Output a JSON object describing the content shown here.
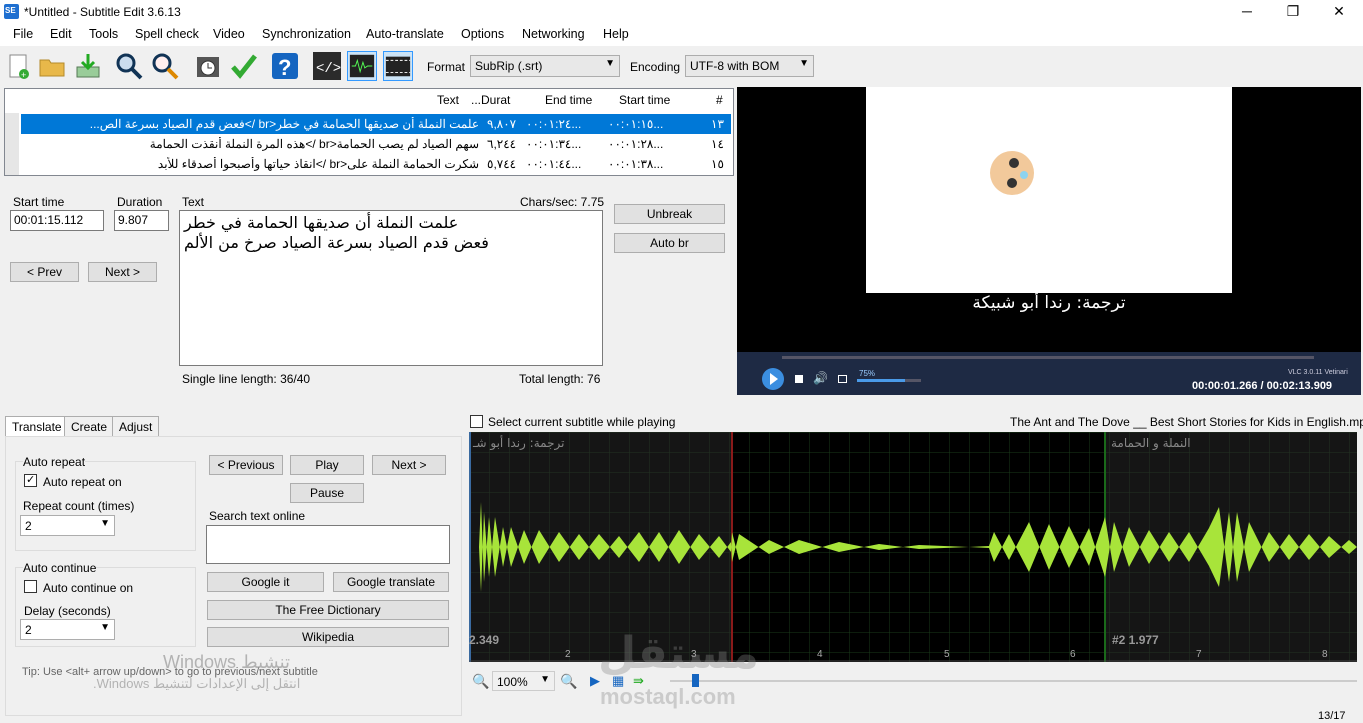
{
  "window": {
    "title": "*Untitled - Subtitle Edit 3.6.13",
    "minimize": "─",
    "maximize": "❐",
    "close": "✕"
  },
  "menu": [
    "File",
    "Edit",
    "Tools",
    "Spell check",
    "Video",
    "Synchronization",
    "Auto-translate",
    "Options",
    "Networking",
    "Help"
  ],
  "toolbar": {
    "format_label": "Format",
    "format_value": "SubRip (.srt)",
    "encoding_label": "Encoding",
    "encoding_value": "UTF-8 with BOM",
    "icons": [
      "new-file-icon",
      "open-folder-icon",
      "download-icon",
      "find-icon",
      "replace-icon",
      "visual-sync-icon",
      "spell-check-icon",
      "help-icon",
      "source-view-icon",
      "waveform-icon",
      "video-icon"
    ]
  },
  "grid": {
    "headers": {
      "num": "#",
      "start": "Start time",
      "end": "End time",
      "duration": "...Durat",
      "text": "Text"
    },
    "rows": [
      {
        "num": "١٣",
        "start": "٠٠:٠١:١٥...",
        "end": "٠٠:٠١:٢٤...",
        "duration": "٩,٨٠٧",
        "text": "علمت النملة أن صديقها الحمامة في خطر<br />فعض قدم الصياد بسرعة الص..."
      },
      {
        "num": "١٤",
        "start": "٠٠:٠١:٢٨...",
        "end": "٠٠:٠١:٣٤...",
        "duration": "٦,٢٤٤",
        "text": "سهم الصياد لم يصب الحمامة<br />هذه المرة النملة أنقذت الحمامة"
      },
      {
        "num": "١٥",
        "start": "٠٠:٠١:٣٨...",
        "end": "٠٠:٠١:٤٤...",
        "duration": "٥,٧٤٤",
        "text": "شكرت الحمامة النملة على<br />انقاذ حياتها وأصبحوا أصدقاء للأبد"
      }
    ]
  },
  "editor": {
    "start_label": "Start time",
    "start_value": "00:01:15.112",
    "duration_label": "Duration",
    "duration_value": "9.807",
    "text_label": "Text",
    "chars_sec": "Chars/sec: 7.75",
    "text_line1": "علمت النملة أن صديقها الحمامة في خطر",
    "text_line2": "فعض قدم الصياد بسرعة الصياد صرخ من الألم",
    "prev": "< Prev",
    "next": "Next >",
    "unbreak": "Unbreak",
    "auto_br": "Auto br",
    "single_line": "Single line length: 36/40",
    "total_length": "Total length: 76"
  },
  "video": {
    "subtitle": "ترجمة: رندا أبو شبيكة",
    "volume": "75%",
    "vlc": "VLC 3.0.11 Vetinari",
    "time": "00:00:01.266 / 00:02:13.909"
  },
  "tabs": [
    "Translate",
    "Create",
    "Adjust"
  ],
  "translate": {
    "auto_repeat": "Auto repeat",
    "auto_repeat_on": "Auto repeat on",
    "repeat_count": "Repeat count (times)",
    "repeat_value": "2",
    "auto_continue": "Auto continue",
    "auto_continue_on": "Auto continue on",
    "delay": "Delay (seconds)",
    "delay_value": "2",
    "previous": "< Previous",
    "play": "Play",
    "next": "Next >",
    "pause": "Pause",
    "search_online": "Search text online",
    "google_it": "Google it",
    "google_translate": "Google translate",
    "free_dictionary": "The Free Dictionary",
    "wikipedia": "Wikipedia",
    "tip": "Tip: Use <alt+ arrow up/down> to go to previous/next subtitle"
  },
  "waveform": {
    "select_current": "Select current subtitle while playing",
    "filename": "The Ant and The Dove __ Best Short Stories for Kids in English.mp4",
    "label_left": "ترجمة: رندا أبو شـ",
    "label_right": "النملة و الحمامة",
    "num_left": "2.349",
    "num_right": "#2  1.977",
    "ticks": [
      "2",
      "3",
      "4",
      "5",
      "6",
      "7",
      "8"
    ],
    "zoom": "100%"
  },
  "watermark": {
    "windows1": "Windows تنشيط",
    "windows2": "انتقل إلى الإعدادات لتنشيط Windows.",
    "brand": "مستقل",
    "brand_url": "mostaql.com"
  },
  "status": "13/17"
}
